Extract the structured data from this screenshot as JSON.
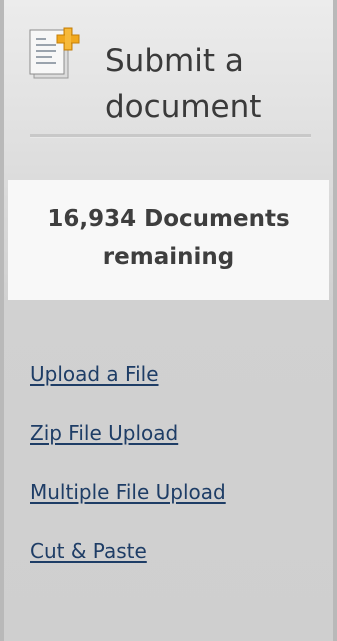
{
  "header": {
    "title": "Submit a\ndocument",
    "icon": "document-add-icon"
  },
  "counter": {
    "text": "16,934 Documents\nremaining"
  },
  "links": [
    {
      "label": "Upload a File"
    },
    {
      "label": "Zip File Upload"
    },
    {
      "label": "Multiple File Upload"
    },
    {
      "label": "Cut & Paste"
    }
  ],
  "colors": {
    "link": "#1e3d66",
    "title": "#3a3a3a",
    "plus_accent": "#f1a81d"
  }
}
